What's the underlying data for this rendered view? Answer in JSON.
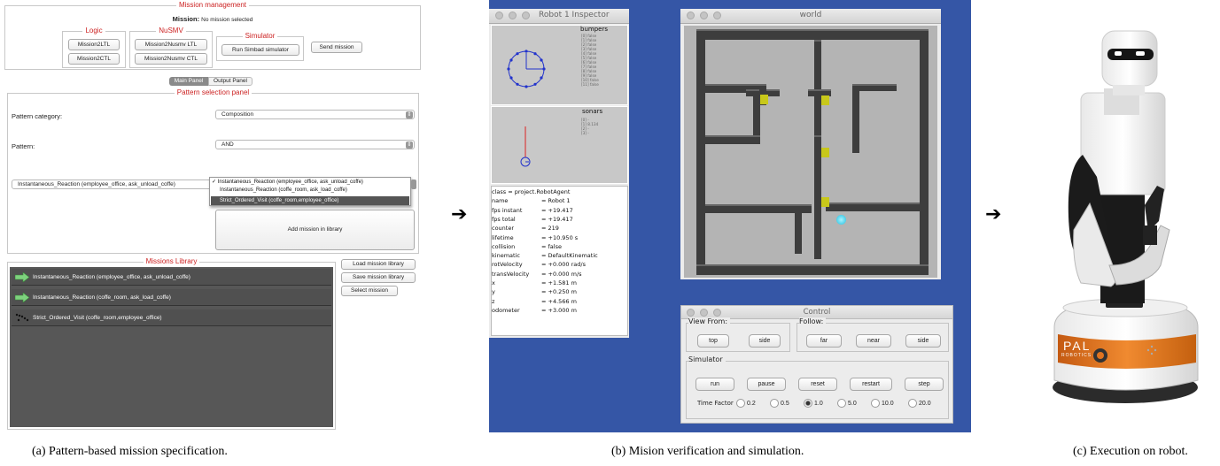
{
  "panel_a": {
    "mission_management": {
      "title": "Mission management",
      "mission_label": "Mission:",
      "mission_value": "No mission selected",
      "logic": {
        "title": "Logic",
        "buttons": [
          "Mission2LTL",
          "Mission2CTL"
        ]
      },
      "nusmv": {
        "title": "NuSMV",
        "buttons": [
          "Mission2Nusmv LTL",
          "Mission2Nusmv CTL"
        ]
      },
      "simulator": {
        "title": "Simulator",
        "button": "Run Simbad simulator"
      },
      "send_button": "Send mission"
    },
    "tabs": [
      "Main Panel",
      "Output Panel"
    ],
    "pattern_panel": {
      "title": "Pattern selection panel",
      "category_label": "Pattern category:",
      "category_value": "Composition",
      "pattern_label": "Pattern:",
      "pattern_value": "AND",
      "left_select": "Instantaneous_Reaction (employee_office, ask_unload_coffe)",
      "dropdown_options": [
        "✓ Instantaneous_Reaction (employee_office, ask_unload_coffe)",
        "Instantaneous_Reaction (coffe_room, ask_load_coffe)",
        "Strict_Ordered_Visit (coffe_room,employee_office)"
      ],
      "add_button": "Add mission in library"
    },
    "library": {
      "title": "Missions Library",
      "items": [
        "Instantaneous_Reaction (employee_office, ask_unload_coffe)",
        "Instantaneous_Reaction (coffe_room, ask_load_coffe)",
        "Strict_Ordered_Visit (coffe_room,employee_office)"
      ],
      "buttons": [
        "Load mission library",
        "Save mission library",
        "Select mission"
      ]
    },
    "caption": "(a) Pattern-based mission specification."
  },
  "panel_b": {
    "inspector": {
      "title": "Robot 1 Inspector",
      "bumpers_title": "bumpers",
      "bumpers": [
        "[0] false",
        "[1] false",
        "[2] false",
        "[3] false",
        "[4] false",
        "[5] false",
        "[6] false",
        "[7] false",
        "[8] false",
        "[9] false",
        "[10] false",
        "[11] false"
      ],
      "sonars_title": "sonars",
      "sonars": [
        "[0] -",
        "[1] 8.134",
        "[2] -",
        "[3] -"
      ],
      "props": [
        [
          "class = project.RobotAgent",
          ""
        ],
        [
          "name",
          "= Robot 1"
        ],
        [
          "fps instant",
          "= +19.417"
        ],
        [
          "fps total",
          "= +19.417"
        ],
        [
          "counter",
          "= 219"
        ],
        [
          "lifetime",
          "= +10.950 s"
        ],
        [
          "collision",
          "= false"
        ],
        [
          "kinematic",
          "= DefaultKinematic"
        ],
        [
          "rotVelocity",
          "= +0.000 rad/s"
        ],
        [
          "transVelocity",
          "= +0.000 m/s"
        ],
        [
          "x",
          "= +1.581 m"
        ],
        [
          "y",
          "= +0.250 m"
        ],
        [
          "z",
          "= +4.566 m"
        ],
        [
          "odometer",
          "= +3.000 m"
        ]
      ]
    },
    "world": {
      "title": "world"
    },
    "control": {
      "title": "Control",
      "view_from": {
        "title": "View From:",
        "buttons": [
          "top",
          "side"
        ]
      },
      "follow": {
        "title": "Follow:",
        "buttons": [
          "far",
          "near",
          "side"
        ]
      },
      "simulator": {
        "title": "Simulator",
        "buttons": [
          "run",
          "pause",
          "reset",
          "restart",
          "step"
        ]
      },
      "time_factor_label": "Time Factor",
      "time_factors": [
        "0.2",
        "0.5",
        "1.0",
        "5.0",
        "10.0",
        "20.0"
      ],
      "selected_factor": "1.0"
    },
    "caption": "(b) Mision verification and simulation."
  },
  "panel_c": {
    "robot_brand": "PAL",
    "robot_brand_sub": "ROBOTICS",
    "caption": "(c) Execution on robot."
  },
  "arrows": [
    "➔",
    "➔"
  ],
  "colors": {
    "group_title": "#cc2222",
    "desktop_blue": "#3556a6",
    "library_bg": "#575757",
    "robot_orange": "#e07420"
  }
}
